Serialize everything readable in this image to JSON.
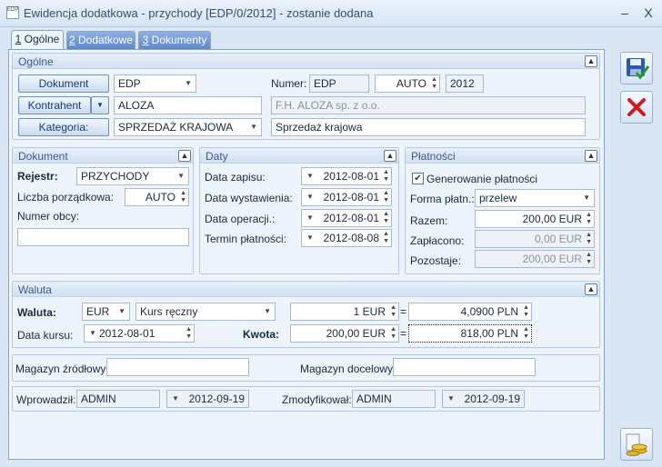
{
  "window": {
    "title": "Ewidencja dodatkowa - przychody [EDP/0/2012] - zostanie dodana",
    "app_icon": "EDP",
    "minimize": "–",
    "close": "X"
  },
  "tabs": [
    {
      "label": "Ogólne",
      "num": "1"
    },
    {
      "label": "Dodatkowe",
      "num": "2"
    },
    {
      "label": "Dokumenty",
      "num": "3"
    }
  ],
  "ogolne": {
    "header": "Ogólne",
    "dokument_btn": "Dokument",
    "dokument_value": "EDP",
    "numer_label": "Numer:",
    "numer_prefix": "EDP",
    "numer_auto": "AUTO",
    "numer_year": "2012",
    "kontrahent_btn": "Kontrahent",
    "kontrahent_value": "ALOZA",
    "kontrahent_name": "F.H. ALOZA sp. z o.o.",
    "kategoria_btn": "Kategoria:",
    "kategoria_value": "SPRZEDAŻ KRAJOWA",
    "kategoria_desc": "Sprzedaż krajowa"
  },
  "dokument": {
    "header": "Dokument",
    "rejestr_label": "Rejestr:",
    "rejestr_value": "PRZYCHODY",
    "lp_label": "Liczba porządkowa:",
    "lp_value": "AUTO",
    "numer_obcy_label": "Numer obcy:",
    "numer_obcy_value": ""
  },
  "daty": {
    "header": "Daty",
    "rows": [
      {
        "label": "Data zapisu:",
        "value": "2012-08-01"
      },
      {
        "label": "Data wystawienia:",
        "value": "2012-08-01"
      },
      {
        "label": "Data operacji.:",
        "value": "2012-08-01"
      },
      {
        "label": "Termin płatności:",
        "value": "2012-08-08"
      }
    ]
  },
  "platnosci": {
    "header": "Płatności",
    "generowanie": "Generowanie płatności",
    "forma_label": "Forma płatn.:",
    "forma_value": "przelew",
    "razem_label": "Razem:",
    "razem_value": "200,00 EUR",
    "zaplacono_label": "Zapłacono:",
    "zaplacono_value": "0,00 EUR",
    "pozostaje_label": "Pozostaje:",
    "pozostaje_value": "200,00 EUR"
  },
  "waluta": {
    "header": "Waluta",
    "waluta_label": "Waluta:",
    "waluta_value": "EUR",
    "kurs_type": "Kurs ręczny",
    "rate_left": "1 EUR",
    "eq1": "=",
    "rate_right": "4,0900 PLN",
    "data_kursu_label": "Data kursu:",
    "data_kursu_value": "2012-08-01",
    "kwota_label": "Kwota:",
    "kwota_left": "200,00 EUR",
    "eq2": "=",
    "kwota_right": "818,00 PLN"
  },
  "magazyn": {
    "zrodlowy_label": "Magazyn źródłowy:",
    "zrodlowy_value": "",
    "docelowy_label": "Magazyn docelowy:",
    "docelowy_value": ""
  },
  "audit": {
    "wprowadzil_label": "Wprowadził:",
    "wprowadzil_user": "ADMIN",
    "wprowadzil_date": "2012-09-19",
    "zmodyfikowal_label": "Zmodyfikował:",
    "zmodyfikowal_user": "ADMIN",
    "zmodyfikowal_date": "2012-09-19"
  },
  "colors": {
    "accent": "#5f87c8",
    "save_icon": "#2a5aa8",
    "cancel_icon": "#d21a1a"
  }
}
